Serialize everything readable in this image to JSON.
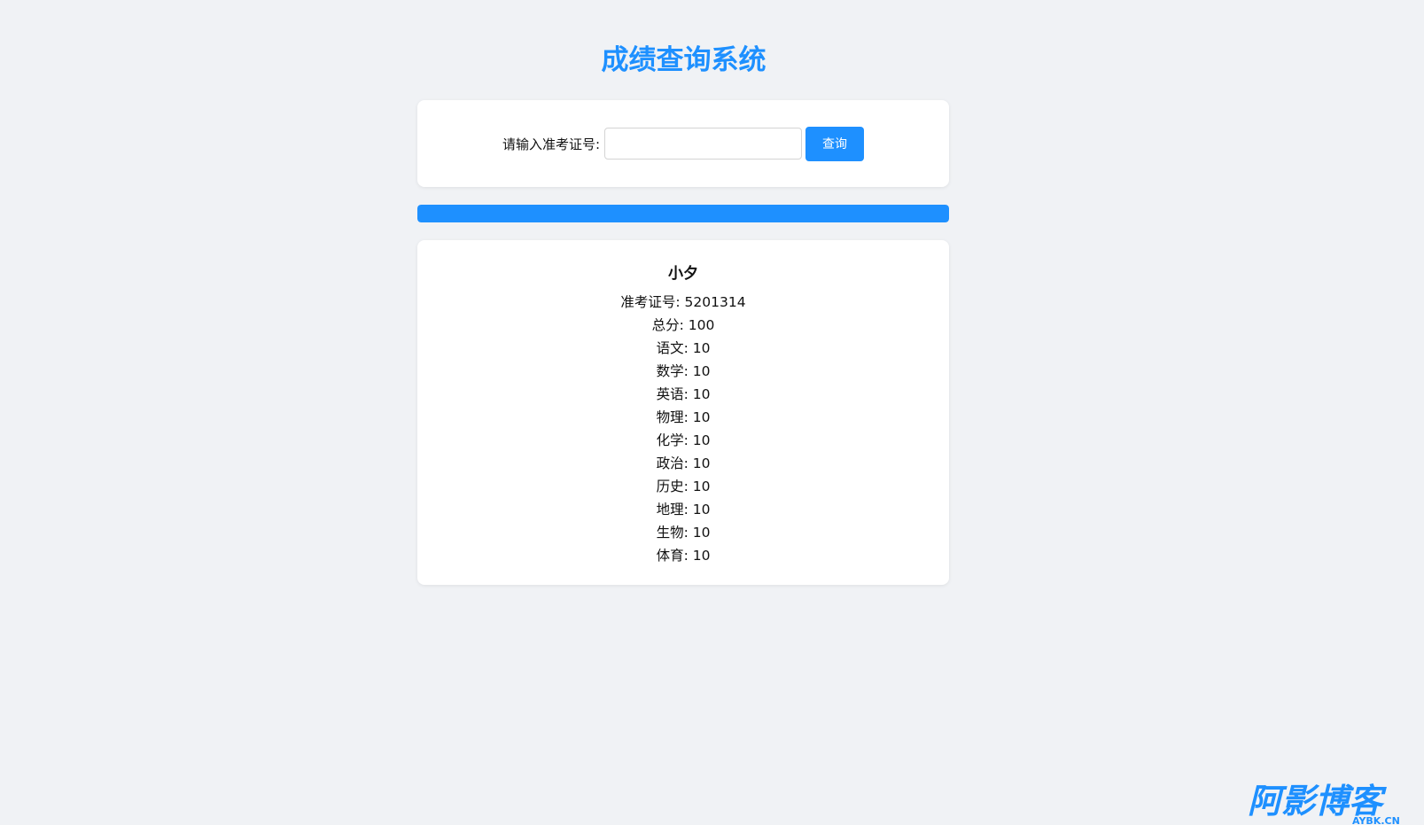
{
  "page": {
    "title": "成绩查询系统"
  },
  "search": {
    "label": "请输入准考证号:",
    "value": "",
    "placeholder": "",
    "button_label": "查询"
  },
  "progress": {
    "percent": 100,
    "color": "#1e90ff"
  },
  "result": {
    "name": "小夕",
    "lines": [
      "准考证号: 5201314",
      "总分: 100",
      "语文: 10",
      "数学: 10",
      "英语: 10",
      "物理: 10",
      "化学: 10",
      "政治: 10",
      "历史: 10",
      "地理: 10",
      "生物: 10",
      "体育: 10"
    ]
  },
  "watermark": {
    "main": "阿影博客",
    "sub": "AYBK.CN"
  },
  "colors": {
    "accent": "#1e90ff",
    "background": "#f0f2f5",
    "card": "#ffffff"
  }
}
